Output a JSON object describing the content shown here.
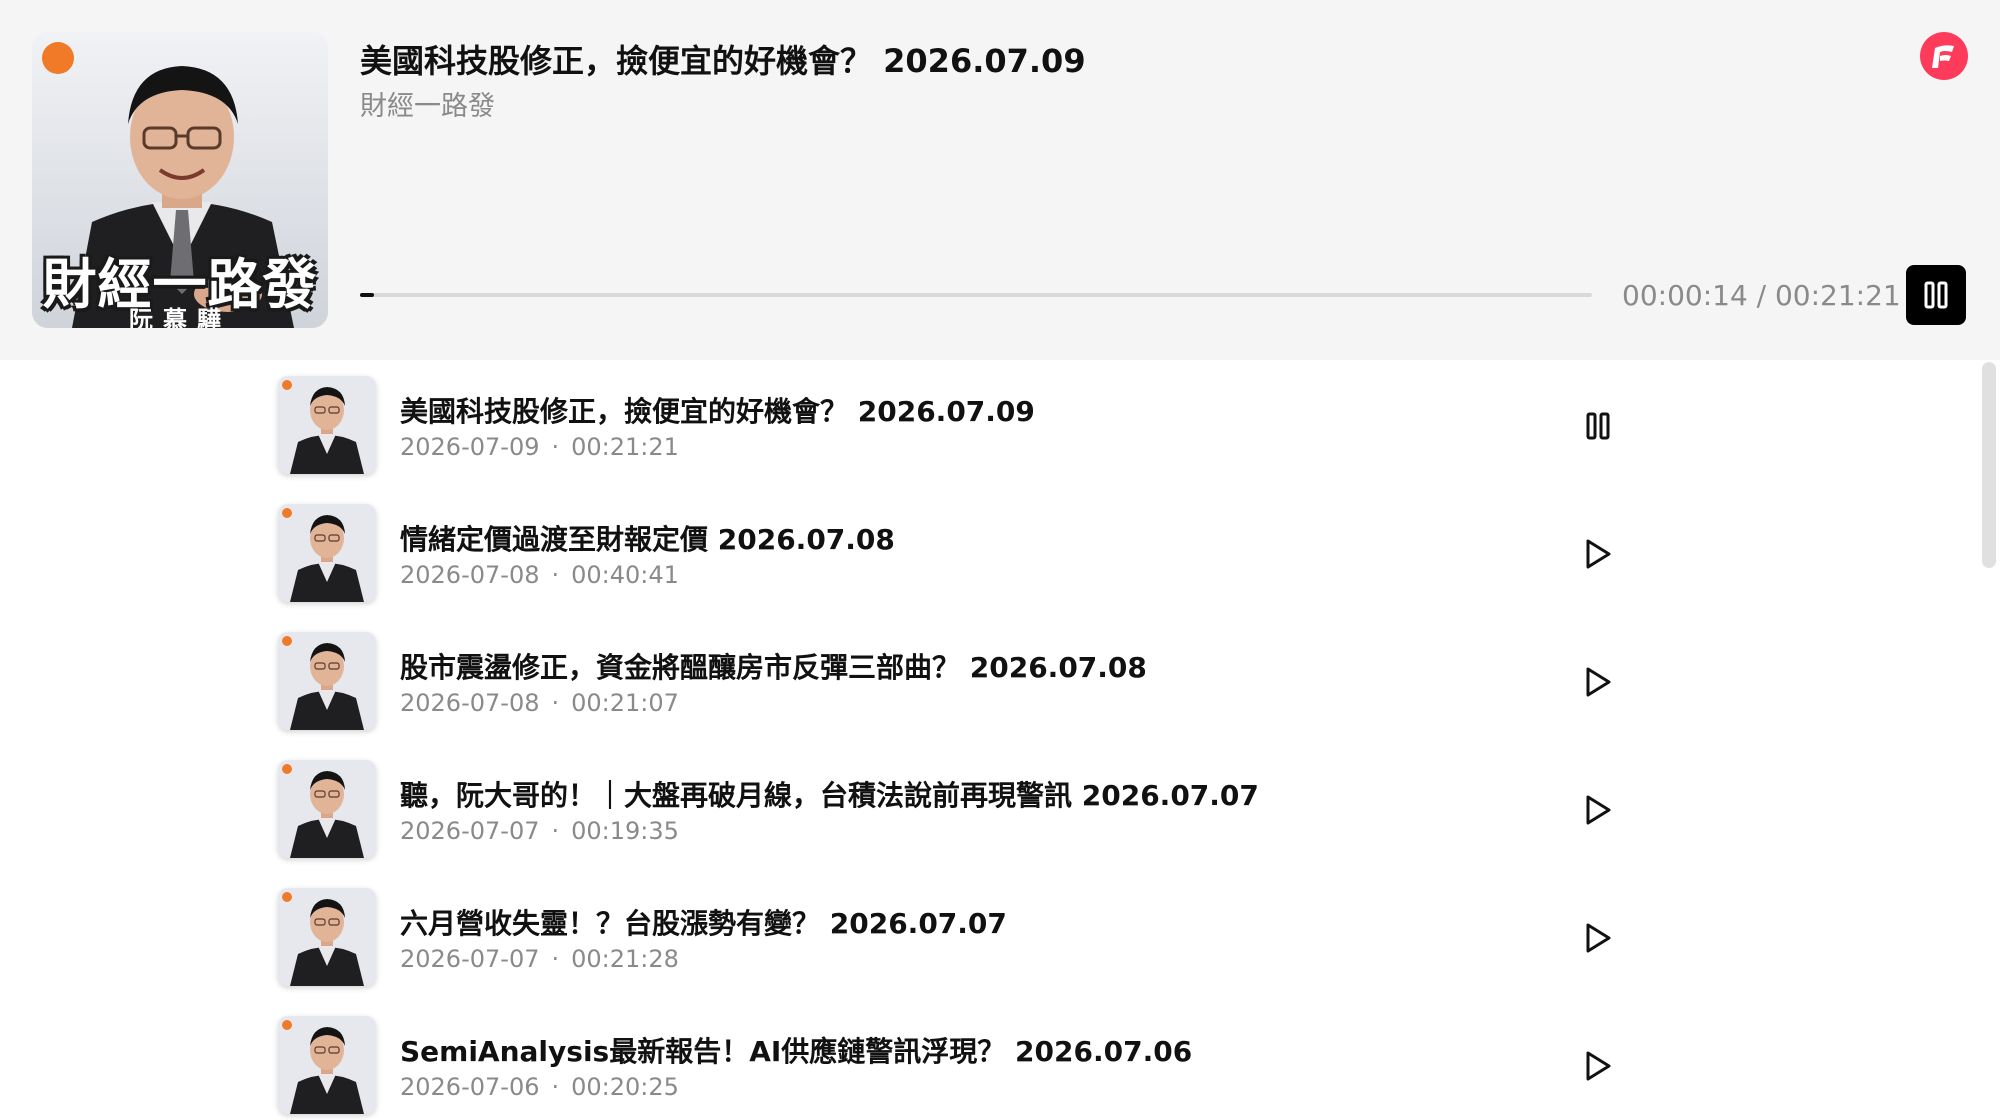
{
  "now_playing": {
    "cover_title": "財經一路發",
    "cover_subtitle": "阮慕驊",
    "title": "美國科技股修正，撿便宜的好機會？ 2026.07.09",
    "author": "財經一路發",
    "current_time": "00:00:14",
    "duration": "00:21:21",
    "time_display": "00:00:14 / 00:21:21",
    "progress": 0.011,
    "state": "playing",
    "main_control_icon": "pause-icon",
    "brand_icon": "firstory-logo-icon",
    "colors": {
      "brand": "#ff3b5c",
      "accent_badge": "#f07a28",
      "progress_fill": "#111111",
      "progress_track": "#d9d9d9"
    }
  },
  "episodes": [
    {
      "title": "美國科技股修正，撿便宜的好機會？ 2026.07.09",
      "date": "2026-07-09",
      "duration": "00:21:21",
      "icon": "pause-icon",
      "state": "playing"
    },
    {
      "title": "情緒定價過渡至財報定價 2026.07.08",
      "date": "2026-07-08",
      "duration": "00:40:41",
      "icon": "play-icon",
      "state": "idle"
    },
    {
      "title": "股市震盪修正，資金將醞釀房市反彈三部曲？ 2026.07.08",
      "date": "2026-07-08",
      "duration": "00:21:07",
      "icon": "play-icon",
      "state": "idle"
    },
    {
      "title": "聽，阮大哥的！｜大盤再破月線，台積法說前再現警訊 2026.07.07",
      "date": "2026-07-07",
      "duration": "00:19:35",
      "icon": "play-icon",
      "state": "idle"
    },
    {
      "title": "六月營收失靈！？台股漲勢有變？ 2026.07.07",
      "date": "2026-07-07",
      "duration": "00:21:28",
      "icon": "play-icon",
      "state": "idle"
    },
    {
      "title": "SemiAnalysis最新報告！AI供應鏈警訊浮現？ 2026.07.06",
      "date": "2026-07-06",
      "duration": "00:20:25",
      "icon": "play-icon",
      "state": "idle"
    }
  ],
  "meta_separator": "·",
  "thumb_label": "財經一路發"
}
